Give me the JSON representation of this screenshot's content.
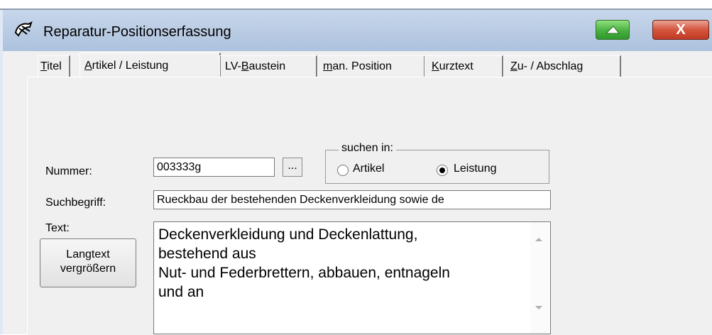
{
  "window": {
    "title": "Reparatur-Positionserfassung",
    "minimize_icon": "minimize-icon",
    "close_label": "X"
  },
  "tabs": [
    {
      "label_parts": [
        "T",
        "itel"
      ]
    },
    {
      "label_parts": [
        "A",
        "rtikel / Leistung"
      ]
    },
    {
      "label_parts": [
        "LV-",
        "B",
        "austein"
      ]
    },
    {
      "label_parts": [
        "m",
        "an. Position"
      ]
    },
    {
      "label_parts": [
        "K",
        "urztext"
      ]
    },
    {
      "label_parts": [
        "Z",
        "u- / Abschlag"
      ]
    }
  ],
  "form": {
    "nummer_label": "Nummer:",
    "nummer_value": "003333g",
    "browse_label": "...",
    "search_group_label": "suchen in:",
    "radio_artikel_label": "Artikel",
    "radio_leistung_label": "Leistung",
    "selected_radio": "Leistung",
    "suchbegriff_label": "Suchbegriff:",
    "suchbegriff_value": "Rueckbau der bestehenden Deckenverkleidung sowie de",
    "text_label": "Text:",
    "langtext_button_line1": "Langtext",
    "langtext_button_line2": "vergrößern",
    "text_lines": [
      "Deckenverkleidung und Deckenlattung,",
      "bestehend aus",
      "Nut- und Federbrettern, abbauen, entnageln",
      "und an"
    ]
  }
}
